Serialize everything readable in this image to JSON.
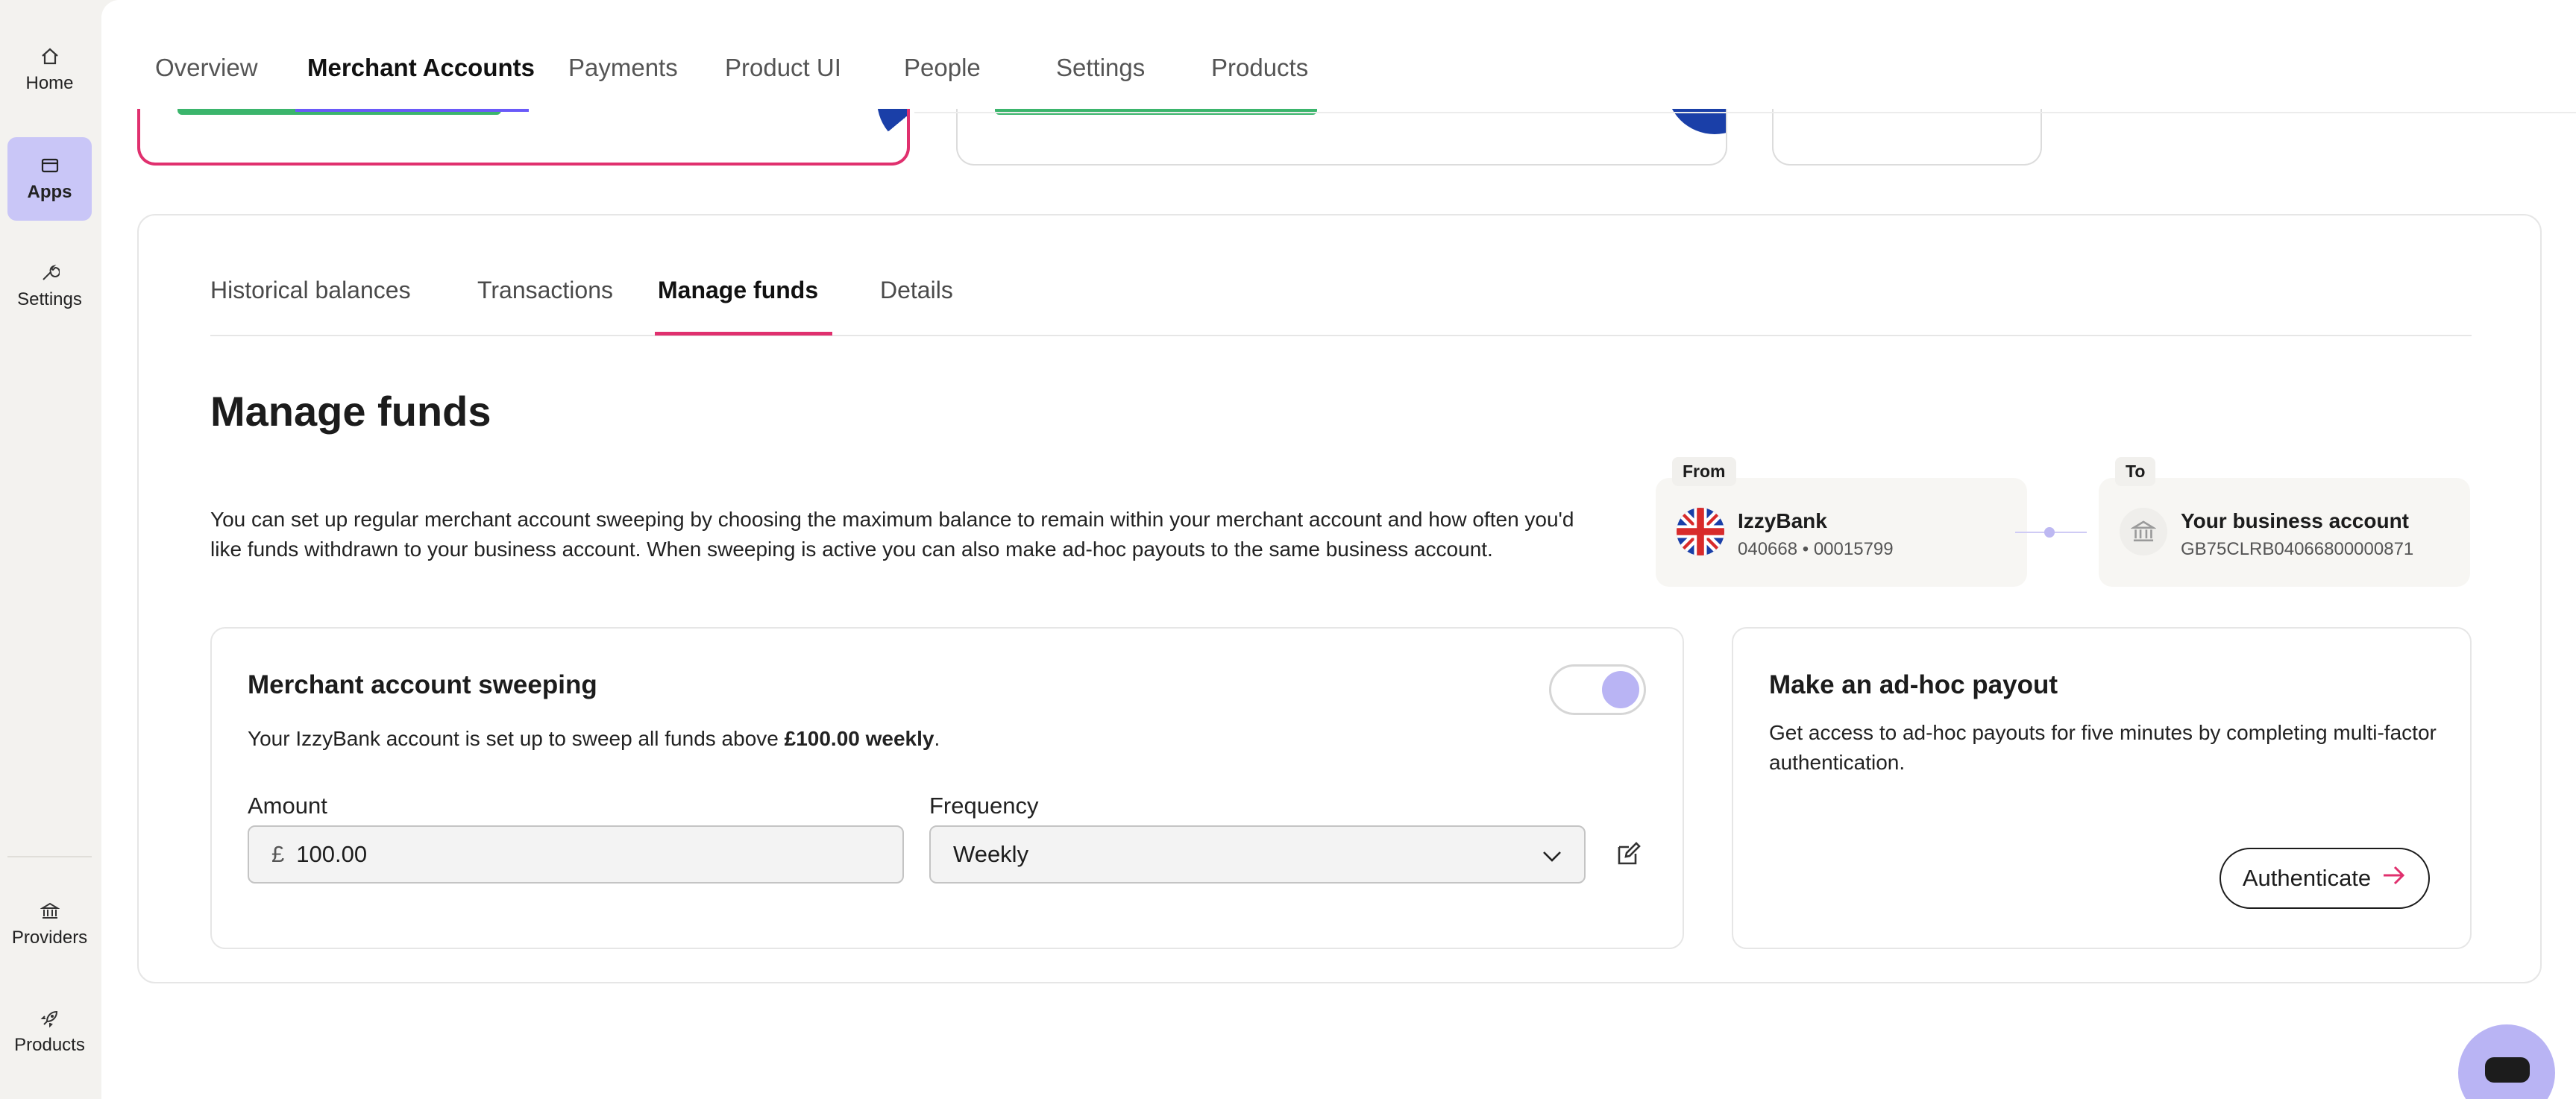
{
  "sidebar": {
    "items": [
      {
        "label": "Home",
        "icon": "home-icon"
      },
      {
        "label": "Apps",
        "icon": "apps-icon",
        "active": true
      },
      {
        "label": "Settings",
        "icon": "wrench-icon"
      }
    ],
    "bottom_items": [
      {
        "label": "Providers",
        "icon": "bank-icon"
      },
      {
        "label": "Products",
        "icon": "rocket-icon"
      }
    ]
  },
  "topnav": {
    "tabs": [
      {
        "label": "Overview"
      },
      {
        "label": "Merchant Accounts",
        "active": true
      },
      {
        "label": "Payments"
      },
      {
        "label": "Product UI"
      },
      {
        "label": "People"
      },
      {
        "label": "Settings"
      },
      {
        "label": "Products"
      }
    ]
  },
  "subtabs": [
    {
      "label": "Historical balances"
    },
    {
      "label": "Transactions"
    },
    {
      "label": "Manage funds",
      "active": true
    },
    {
      "label": "Details"
    }
  ],
  "manage": {
    "title": "Manage funds",
    "description": "You can set up regular merchant account sweeping by choosing the maximum balance to remain within your merchant account and how often you'd like funds withdrawn to your business account. When sweeping is active you can also make ad-hoc payouts to the same business account."
  },
  "from": {
    "label": "From",
    "name": "IzzyBank",
    "details": "040668 • 00015799"
  },
  "to": {
    "label": "To",
    "name": "Your business account",
    "details": "GB75CLRB04066800000871"
  },
  "sweeping": {
    "title": "Merchant account sweeping",
    "text_prefix": "Your IzzyBank account is set up to sweep all funds above ",
    "text_bold": "£100.00 weekly",
    "text_suffix": ".",
    "enabled": true,
    "amount_label": "Amount",
    "currency": "£",
    "amount_value": "100.00",
    "frequency_label": "Frequency",
    "frequency_value": "Weekly"
  },
  "payout": {
    "title": "Make an ad-hoc payout",
    "text": "Get access to ad-hoc payouts for five minutes by completing multi-factor authentication.",
    "button_label": "Authenticate"
  },
  "colors": {
    "accent": "#6a5af9",
    "highlight": "#e0306e",
    "success": "#3bb56c",
    "toggle_knob": "#b9b4f4"
  }
}
